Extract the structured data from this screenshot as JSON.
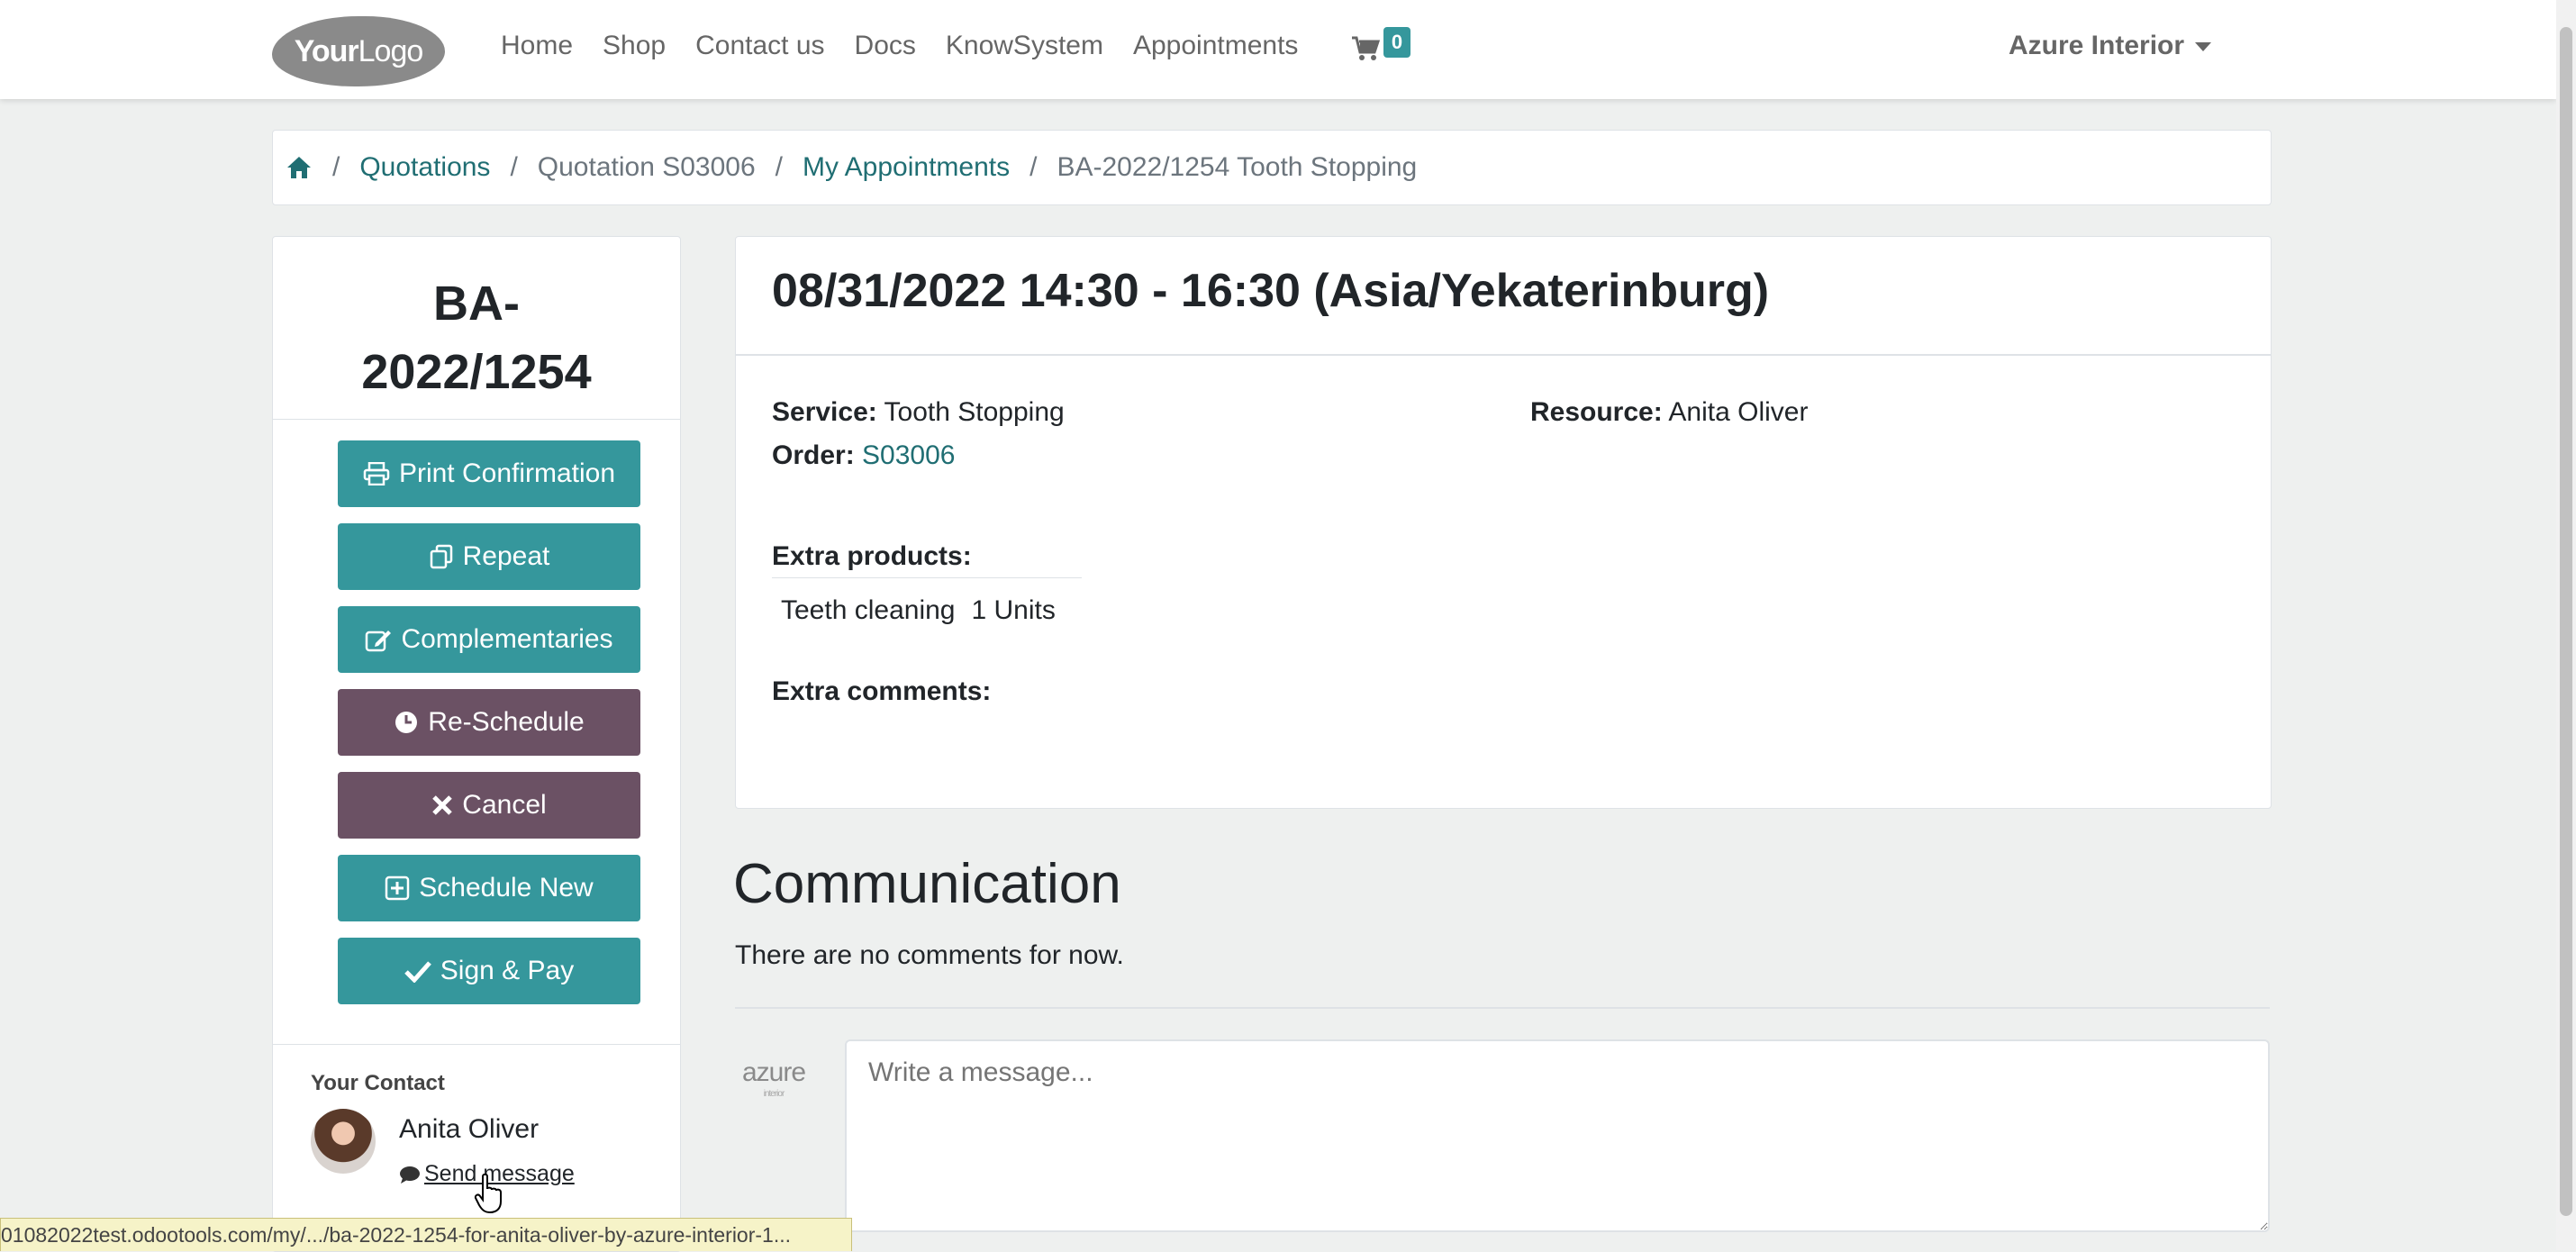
{
  "navbar": {
    "logo_text_bold": "Your",
    "logo_text": "Logo",
    "links": [
      "Home",
      "Shop",
      "Contact us",
      "Docs",
      "KnowSystem",
      "Appointments"
    ],
    "cart_count": "0",
    "user": "Azure Interior"
  },
  "breadcrumb": {
    "items": [
      "Quotations",
      "Quotation S03006",
      "My Appointments",
      "BA-2022/1254 Tooth Stopping"
    ]
  },
  "sidebar": {
    "title_line1": "BA-",
    "title_line2": "2022/1254",
    "buttons": {
      "print": "Print Confirmation",
      "repeat": "Repeat",
      "complementaries": "Complementaries",
      "reschedule": "Re-Schedule",
      "cancel": "Cancel",
      "schedule_new": "Schedule New",
      "sign_pay": "Sign & Pay"
    },
    "contact_label": "Your Contact",
    "contact_name": "Anita Oliver",
    "send_message": "Send message"
  },
  "appointment": {
    "datetime": "08/31/2022 14:30 - 16:30 (Asia/Yekaterinburg)",
    "service_label": "Service:",
    "service_value": "Tooth Stopping",
    "order_label": "Order:",
    "order_value": "S03006",
    "resource_label": "Resource:",
    "resource_value": "Anita Oliver",
    "extra_products_label": "Extra products:",
    "extra_products": [
      {
        "name": "Teeth cleaning",
        "qty": "1 Units"
      }
    ],
    "extra_comments_label": "Extra comments:"
  },
  "communication": {
    "title": "Communication",
    "empty_text": "There are no comments for now.",
    "company_logo": "azure",
    "company_logo_sub": "interior",
    "message_placeholder": "Write a message..."
  },
  "status_bar": {
    "url": "01082022test.odootools.com/my/.../ba-2022-1254-for-anita-oliver-by-azure-interior-1..."
  },
  "colors": {
    "teal": "#35979c",
    "purple": "#6b5164",
    "link": "#206e73"
  }
}
